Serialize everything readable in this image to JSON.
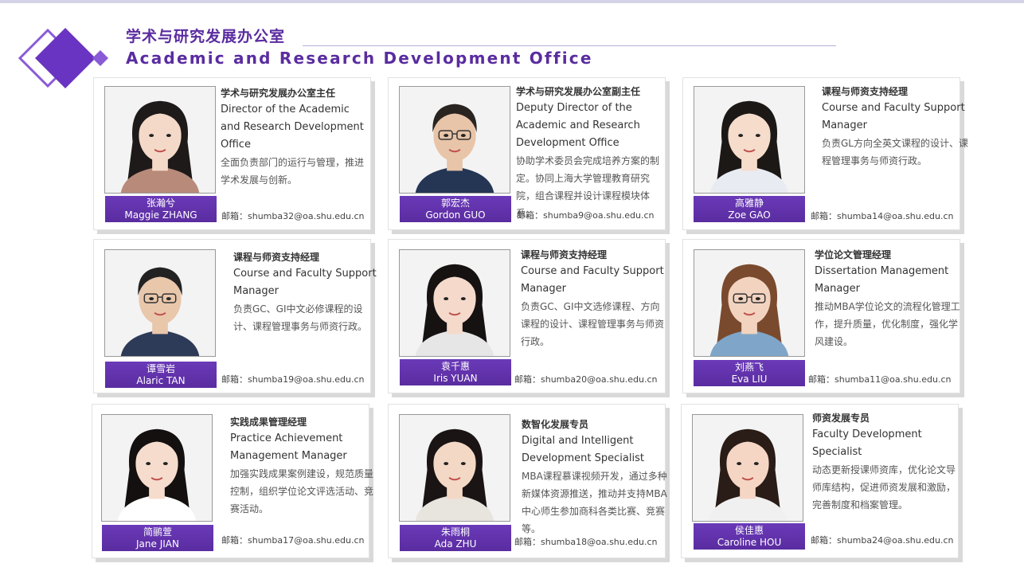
{
  "header": {
    "title_cn": "学术与研究发展办公室",
    "title_en": "Academic and Research Development Office"
  },
  "colors": {
    "accent": "#5a2ca0",
    "accent_light": "#8a5bd6"
  },
  "staff": [
    {
      "name_cn": "张瀚兮",
      "name_en": "Maggie ZHANG",
      "role_cn": "学术与研究发展办公室主任",
      "role_en": "Director of the Academic and Research Development Office",
      "desc": "全面负责部门的运行与管理，推进学术发展与创新。",
      "email": "邮箱：shumba32@oa.shu.edu.cn"
    },
    {
      "name_cn": "郭宏杰",
      "name_en": "Gordon GUO",
      "role_cn": "学术与研究发展办公室副主任",
      "role_en": "Deputy Director of the\n Academic and Research\nDevelopment Office",
      "desc": "协助学术委员会完成培养方案的制定。协同上海大学管理教育研究院，组合课程并设计课程模块体系。",
      "email": "邮箱：shumba9@oa.shu.edu.cn"
    },
    {
      "name_cn": "高雅静",
      "name_en": "Zoe GAO",
      "role_cn": "课程与师资支持经理",
      "role_en": "Course and Faculty Support Manager",
      "desc": "负责GL方向全英文课程的设计、课程管理事务与师资行政。",
      "email": "邮箱：shumba14@oa.shu.edu.cn"
    },
    {
      "name_cn": "谭雪岩",
      "name_en": "Alaric TAN",
      "role_cn": "课程与师资支持经理",
      "role_en": "Course and Faculty Support Manager",
      "desc": "负责GC、GI中文必修课程的设计、课程管理事务与师资行政。",
      "email": "邮箱：shumba19@oa.shu.edu.cn"
    },
    {
      "name_cn": "袁千惠",
      "name_en": "Iris YUAN",
      "role_cn": "课程与师资支持经理",
      "role_en": "Course and Faculty Support Manager",
      "desc": "负责GC、GI中文选修课程、方向课程的设计、课程管理事务与师资行政。",
      "email": "邮箱：shumba20@oa.shu.edu.cn"
    },
    {
      "name_cn": "刘燕飞",
      "name_en": "Eva LIU",
      "role_cn": "学位论文管理经理",
      "role_en": "Dissertation Management Manager",
      "desc": "推动MBA学位论文的流程化管理工作，提升质量，优化制度，强化学风建设。",
      "email": "邮箱：shumba11@oa.shu.edu.cn"
    },
    {
      "name_cn": "简鹂萱",
      "name_en": "Jane JIAN",
      "role_cn": "实践成果管理经理",
      "role_en": "Practice Achievement Management Manager",
      "desc": "加强实践成果案例建设，规范质量控制，组织学位论文评选活动、竞赛活动。",
      "email": "邮箱：shumba17@oa.shu.edu.cn"
    },
    {
      "name_cn": "朱雨桐",
      "name_en": "Ada ZHU",
      "role_cn": "数智化发展专员",
      "role_en": "Digital and Intelligent Development Specialist",
      "desc": "MBA课程慕课视频开发，通过多种新媒体资源推送，推动并支持MBA中心师生参加商科各类比赛、竞赛等。",
      "email": "邮箱：shumba18@oa.shu.edu.cn"
    },
    {
      "name_cn": "侯佳惠",
      "name_en": "Caroline HOU",
      "role_cn": "师资发展专员",
      "role_en": "Faculty Development Specialist",
      "desc": "动态更新授课师资库，优化论文导师库结构，促进师资发展和激励，完善制度和档案管理。",
      "email": "邮箱：shumba24@oa.shu.edu.cn"
    }
  ]
}
